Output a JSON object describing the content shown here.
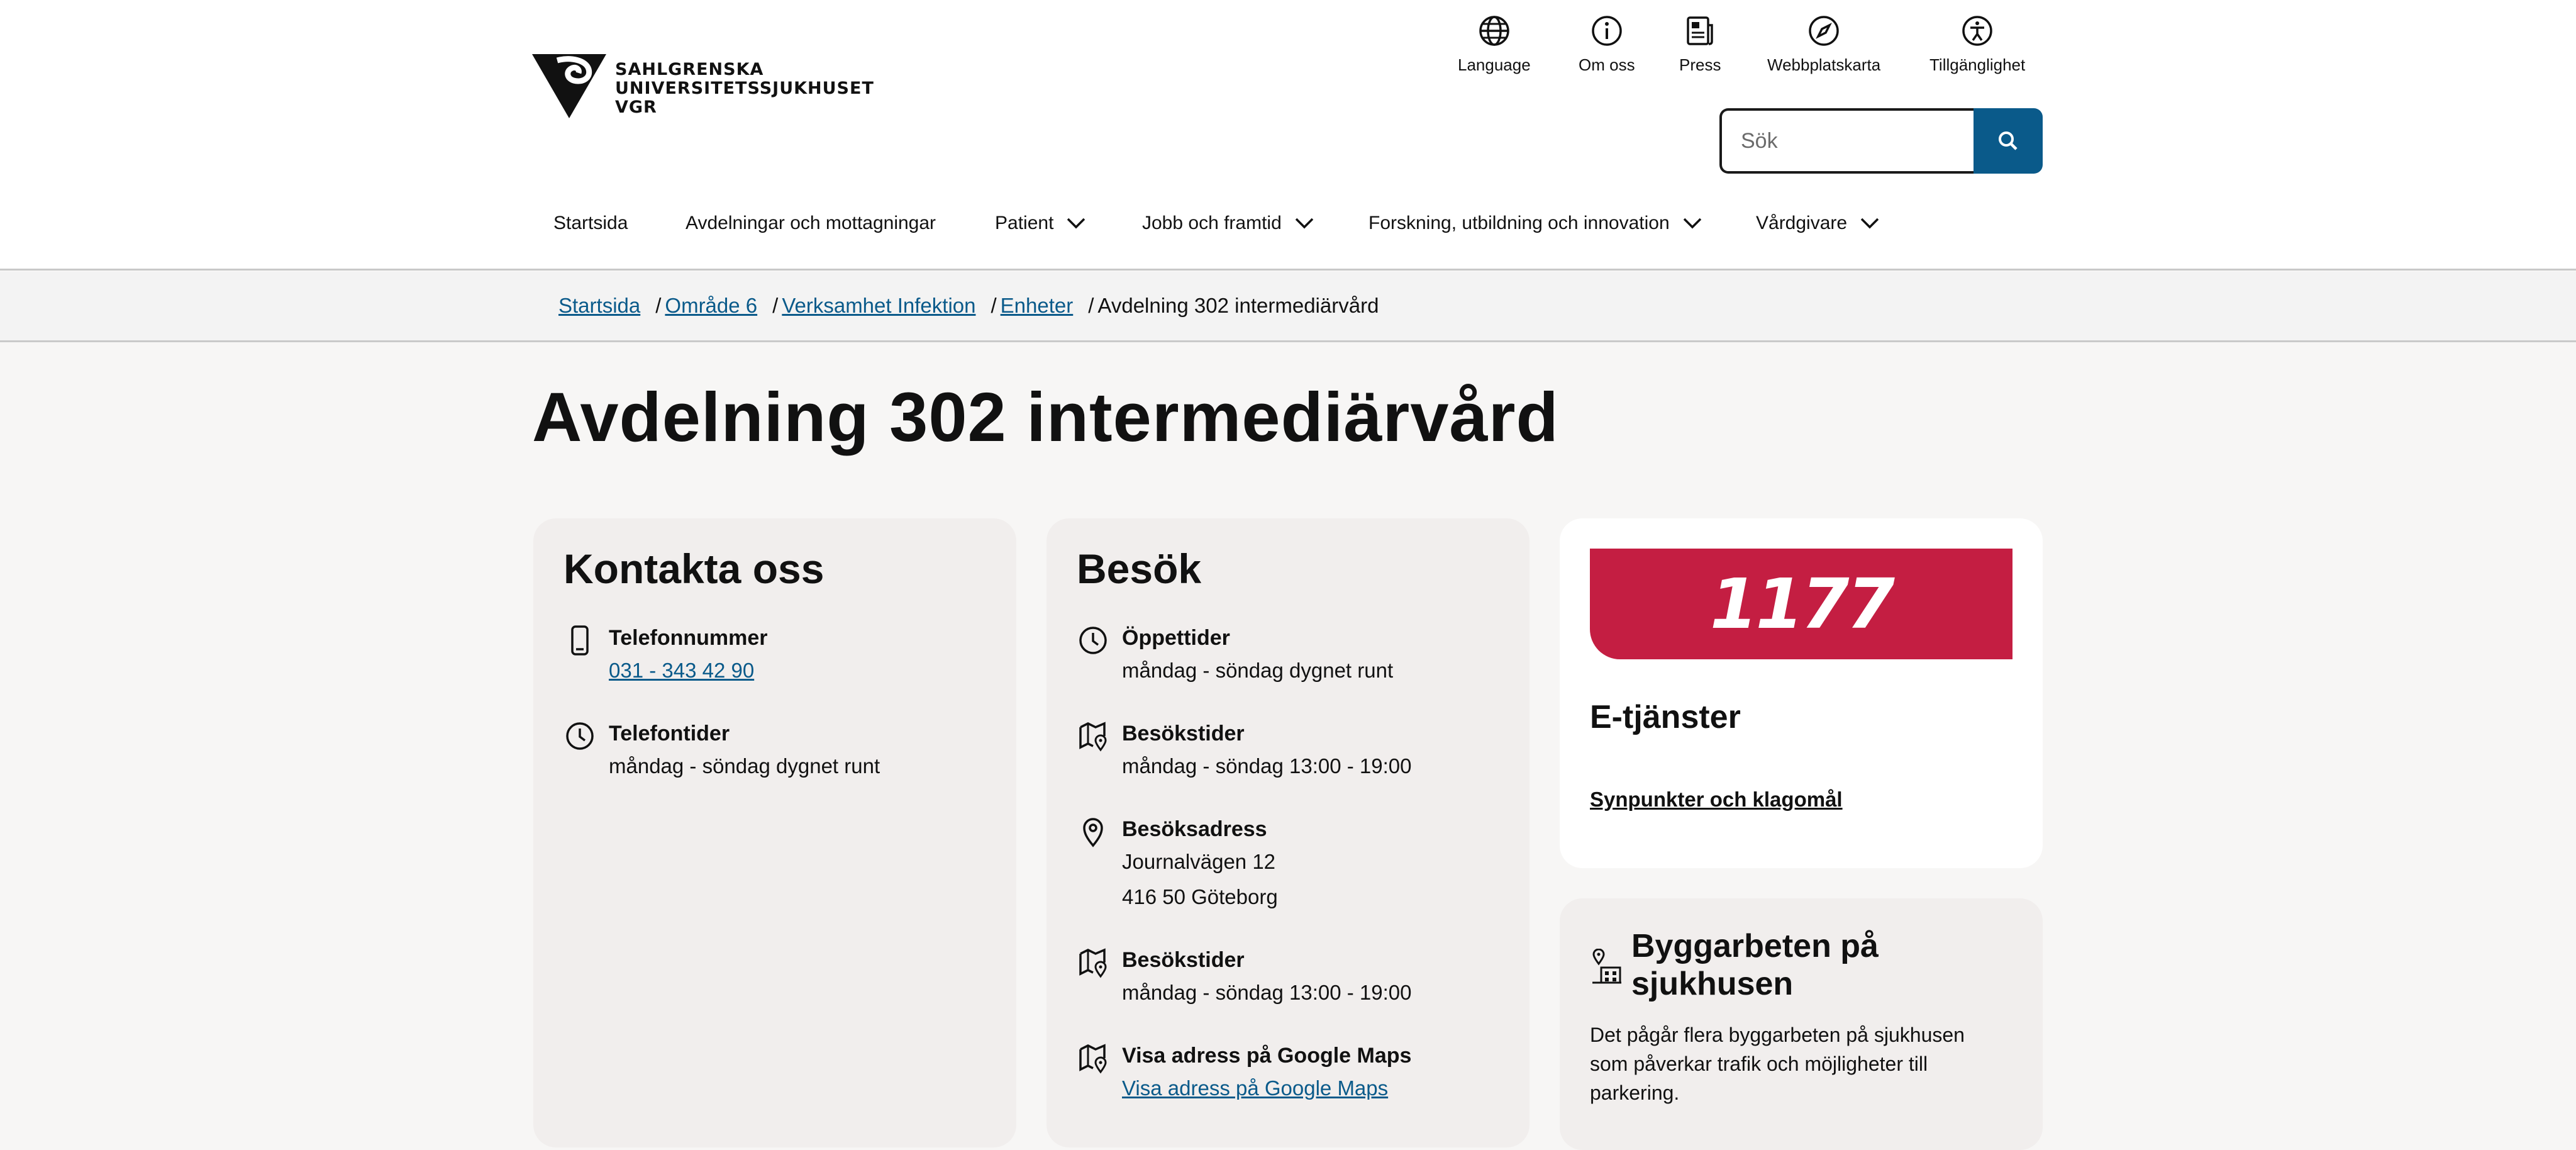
{
  "logo": {
    "line1": "SAHLGRENSKA",
    "line2": "UNIVERSITETSSJUKHUSET",
    "line3": "VGR"
  },
  "utility_nav": [
    {
      "label": "Language",
      "icon": "globe-icon"
    },
    {
      "label": "Om oss",
      "icon": "info-icon"
    },
    {
      "label": "Press",
      "icon": "newspaper-icon"
    },
    {
      "label": "Webbplatskarta",
      "icon": "compass-icon"
    },
    {
      "label": "Tillgänglighet",
      "icon": "accessibility-icon"
    }
  ],
  "search": {
    "placeholder": "Sök",
    "button_icon": "search-icon"
  },
  "main_nav": [
    {
      "label": "Startsida",
      "has_dropdown": false
    },
    {
      "label": "Avdelningar och mottagningar",
      "has_dropdown": false
    },
    {
      "label": "Patient",
      "has_dropdown": true
    },
    {
      "label": "Jobb och framtid",
      "has_dropdown": true
    },
    {
      "label": "Forskning, utbildning och innovation",
      "has_dropdown": true
    },
    {
      "label": "Vårdgivare",
      "has_dropdown": true
    }
  ],
  "breadcrumb": [
    {
      "label": "Startsida",
      "link": true
    },
    {
      "label": "Område 6",
      "link": true
    },
    {
      "label": "Verksamhet Infektion",
      "link": true
    },
    {
      "label": "Enheter",
      "link": true
    },
    {
      "label": "Avdelning 302 intermediärvård",
      "link": false
    }
  ],
  "page_title": "Avdelning 302 intermediärvård",
  "contact": {
    "title": "Kontakta oss",
    "phone_label": "Telefonnummer",
    "phone_value": "031 - 343 42 90",
    "phone_times_label": "Telefontider",
    "phone_times_value": "måndag - söndag dygnet runt"
  },
  "visit": {
    "title": "Besök",
    "opening_label": "Öppettider",
    "opening_value": "måndag - söndag dygnet runt",
    "visiting_label": "Besökstider",
    "visiting_value": "måndag - söndag 13:00 - 19:00",
    "address_label": "Besöksadress",
    "address_line1": "Journalvägen 12",
    "address_line2": "416 50 Göteborg",
    "visiting2_label": "Besökstider",
    "visiting2_value": "måndag - söndag 13:00 - 19:00",
    "maps_label": "Visa adress på Google Maps",
    "maps_link": "Visa adress på Google Maps"
  },
  "eservices": {
    "banner": "1177",
    "title": "E-tjänster",
    "link": "Synpunkter och klagomål"
  },
  "construction": {
    "title_line1": "Byggarbeten på",
    "title_line2": "sjukhusen",
    "text_line1": "Det pågår flera byggarbeten på sjukhusen",
    "text_line2": "som påverkar trafik och möjligheter till",
    "text_line3": "parkering."
  },
  "colors": {
    "link": "#0a5a8a",
    "search_button": "#0a5a8a",
    "banner_1177": "#c41e42",
    "card_bg": "#f1eeed"
  }
}
